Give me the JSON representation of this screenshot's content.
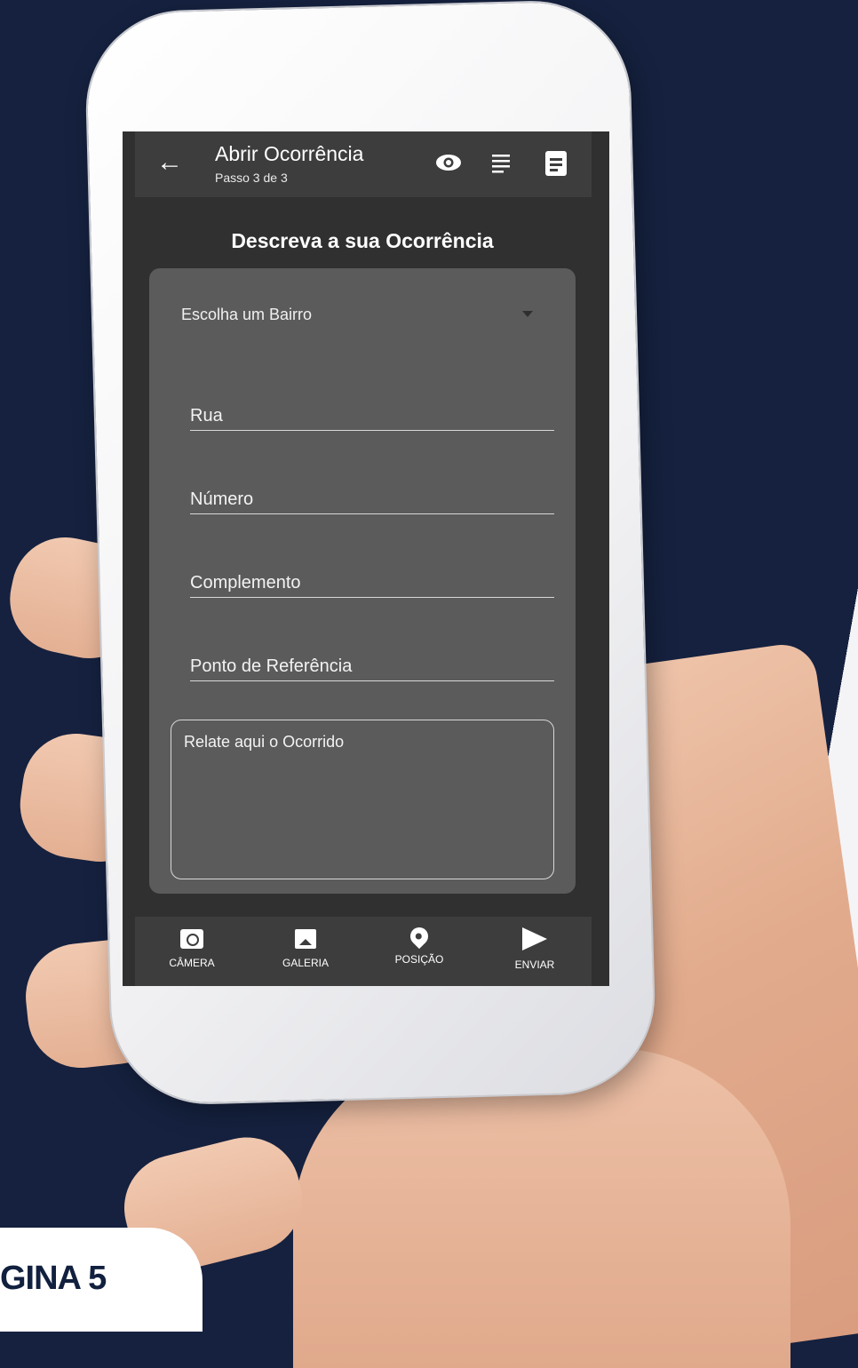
{
  "colors": {
    "background": "#15213f",
    "screen": "#303030",
    "appbar": "#3d3d3d",
    "card": "#5b5b5b",
    "text": "#ffffff"
  },
  "appbar": {
    "back_icon": "arrow-left-icon",
    "title": "Abrir Ocorrência",
    "subtitle": "Passo 3 de 3",
    "actions": [
      "eye-icon",
      "list-icon",
      "document-icon"
    ]
  },
  "main": {
    "heading": "Descreva a sua Ocorrência",
    "bairro_select": {
      "placeholder": "Escolha um Bairro",
      "icon": "dropdown-arrow-icon"
    },
    "fields": {
      "rua": "Rua",
      "numero": "Número",
      "complemento": "Complemento",
      "referencia": "Ponto de Referência"
    },
    "relato_placeholder": "Relate aqui o Ocorrido"
  },
  "bottom_nav": {
    "items": [
      {
        "label": "CÂMERA",
        "icon": "camera-icon"
      },
      {
        "label": "GALERIA",
        "icon": "gallery-icon"
      },
      {
        "label": "POSIÇÃO",
        "icon": "location-pin-icon"
      },
      {
        "label": "ENVIAR",
        "icon": "send-icon"
      }
    ]
  },
  "page_tag": "GINA 5"
}
